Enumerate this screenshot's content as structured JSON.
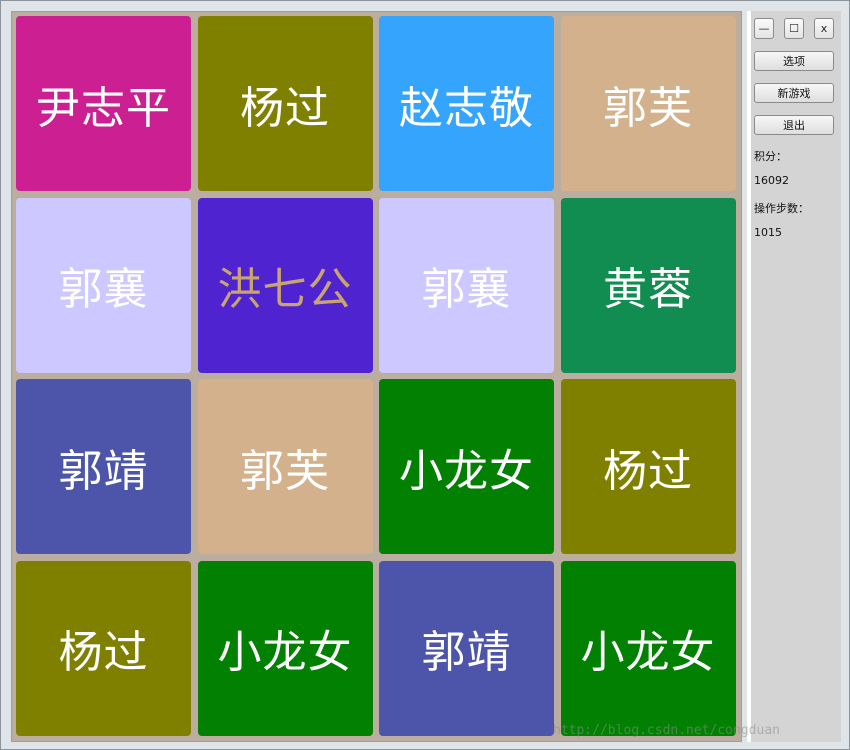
{
  "board": {
    "tiles": [
      {
        "label": "尹志平",
        "bg": "#cc1f91",
        "fg": "#ffffff"
      },
      {
        "label": "杨过",
        "bg": "#808000",
        "fg": "#ffffff"
      },
      {
        "label": "赵志敬",
        "bg": "#35a4fd",
        "fg": "#ffffff"
      },
      {
        "label": "郭芙",
        "bg": "#d2b18c",
        "fg": "#ffffff"
      },
      {
        "label": "郭襄",
        "bg": "#cdc8ff",
        "fg": "#ffffff"
      },
      {
        "label": "洪七公",
        "bg": "#4f23cf",
        "fg": "#c8a46e"
      },
      {
        "label": "郭襄",
        "bg": "#cdc8ff",
        "fg": "#ffffff"
      },
      {
        "label": "黄蓉",
        "bg": "#118d51",
        "fg": "#ffffff"
      },
      {
        "label": "郭靖",
        "bg": "#4c55a9",
        "fg": "#ffffff"
      },
      {
        "label": "郭芙",
        "bg": "#d2b18c",
        "fg": "#ffffff"
      },
      {
        "label": "小龙女",
        "bg": "#028002",
        "fg": "#ffffff"
      },
      {
        "label": "杨过",
        "bg": "#808000",
        "fg": "#ffffff"
      },
      {
        "label": "杨过",
        "bg": "#808000",
        "fg": "#ffffff"
      },
      {
        "label": "小龙女",
        "bg": "#028002",
        "fg": "#ffffff"
      },
      {
        "label": "郭靖",
        "bg": "#4c55a9",
        "fg": "#ffffff"
      },
      {
        "label": "小龙女",
        "bg": "#028002",
        "fg": "#ffffff"
      }
    ]
  },
  "window_controls": {
    "minimize": "—",
    "maximize": "☐",
    "close": "x"
  },
  "controls": {
    "options_label": "选项",
    "new_game_label": "新游戏",
    "exit_label": "退出"
  },
  "stats": {
    "score_label": "积分：",
    "score_value": "16092",
    "steps_label": "操作步数：",
    "steps_value": "1015"
  },
  "watermark": "http://blog.csdn.net/congduan"
}
